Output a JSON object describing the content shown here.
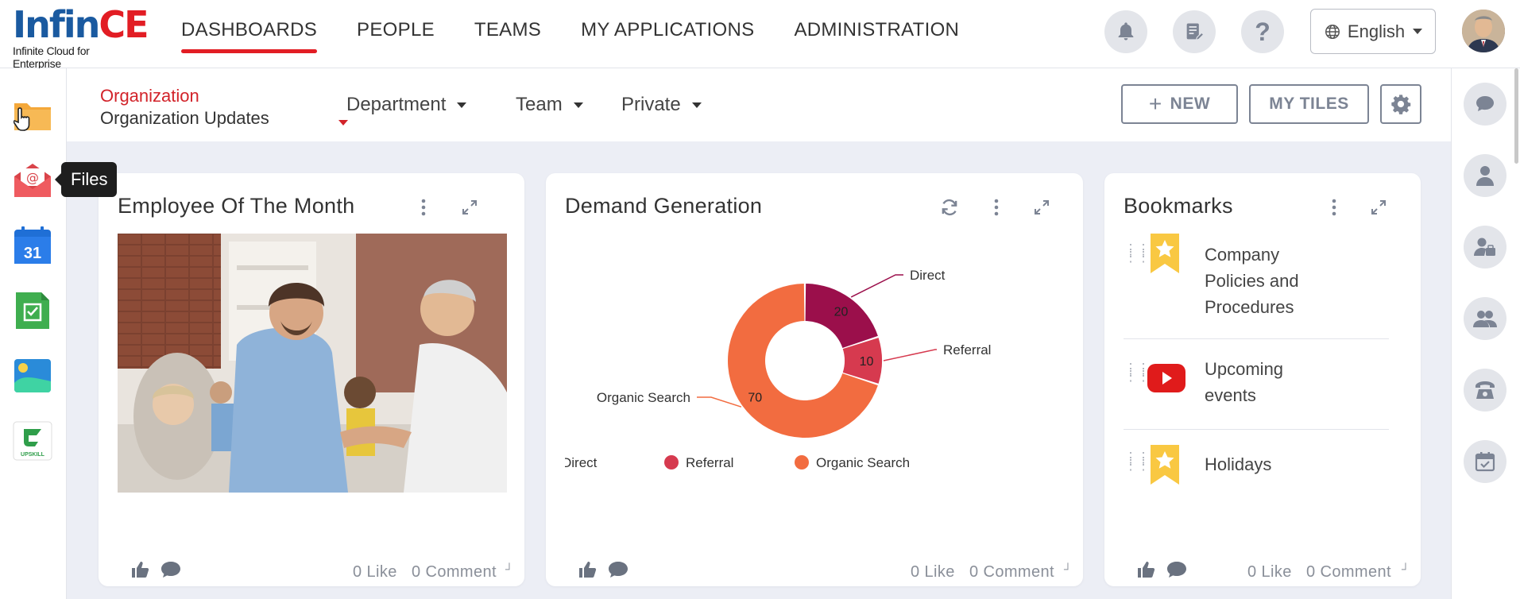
{
  "brand": {
    "name_main": "Infin",
    "name_accent": "CE",
    "tagline": "Infinite Cloud for Enterprise"
  },
  "nav": {
    "items": [
      "DASHBOARDS",
      "PEOPLE",
      "TEAMS",
      "MY APPLICATIONS",
      "ADMINISTRATION"
    ],
    "active": "DASHBOARDS"
  },
  "header": {
    "language": "English"
  },
  "leftrail": {
    "tooltip": "Files",
    "apps": [
      "files-icon",
      "email-icon",
      "calendar-icon",
      "tasks-icon",
      "gallery-icon",
      "upskill-icon"
    ],
    "calendar_day": "31",
    "upskill_text": "UPSKILL"
  },
  "subnav": {
    "org_label": "Organization",
    "org_value": "Organization Updates",
    "tabs": [
      "Department",
      "Team",
      "Private"
    ],
    "new_label": "NEW",
    "mytiles_label": "MY TILES"
  },
  "cards": {
    "employee": {
      "title": "Employee Of The Month",
      "likes": "0 Like",
      "comments": "0 Comment"
    },
    "demand": {
      "title": "Demand Generation",
      "likes": "0 Like",
      "comments": "0 Comment"
    },
    "bookmarks": {
      "title": "Bookmarks",
      "items": [
        {
          "label_lines": [
            "Company",
            "Policies and",
            "Procedures"
          ],
          "icon": "star-bookmark-icon"
        },
        {
          "label_lines": [
            "Upcoming",
            "events"
          ],
          "icon": "youtube-icon"
        },
        {
          "label_lines": [
            "Holidays"
          ],
          "icon": "star-bookmark-icon"
        }
      ],
      "likes": "0 Like",
      "comments": "0 Comment"
    }
  },
  "chart_data": {
    "type": "pie",
    "donut": true,
    "categories": [
      "Direct",
      "Referral",
      "Organic Search"
    ],
    "values": [
      20,
      10,
      70
    ],
    "colors": [
      "#9b0f4b",
      "#d63a4f",
      "#f26c40"
    ],
    "value_labels": [
      "20",
      "10",
      "70"
    ],
    "legend": [
      "Direct",
      "Referral",
      "Organic Search"
    ],
    "legend_position": "bottom"
  },
  "rightrail": {
    "icons": [
      "chat-icon",
      "user-icon",
      "user-network-icon",
      "group-icon",
      "phone-icon",
      "calendar-check-icon"
    ]
  }
}
